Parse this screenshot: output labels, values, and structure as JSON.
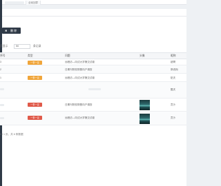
{
  "topbar": {
    "active_tab": "全案回罪"
  },
  "toolbar": {
    "delete_label": "删 除"
  },
  "pager": {
    "prefix": "页显示",
    "page_size": "50",
    "suffix": "条记录"
  },
  "table": {
    "headers": [
      "序号",
      "类型",
      "问题",
      "头像",
      "昵称"
    ],
    "rows": [
      {
        "id": "3",
        "type": "一事一议",
        "type_color": "orange",
        "question": "远程访—向试大学第交试卷",
        "has_avatar": false,
        "nickname": "超哥"
      },
      {
        "id": "2",
        "type": "",
        "type_color": "",
        "question": "日期刊院校院基向户调查",
        "has_avatar": false,
        "nickname": "郭说而"
      },
      {
        "id": "1",
        "type": "一事一议",
        "type_color": "orange",
        "question": "远程访—向试大学第交试卷",
        "has_avatar": false,
        "nickname": "贴夫"
      },
      {
        "id": "",
        "type": "",
        "type_color": "",
        "question": "",
        "has_avatar": false,
        "nickname": "酷夫"
      },
      {
        "id": "",
        "type": "一事一议",
        "type_color": "red",
        "question": "日期刊院校院基向户调查",
        "has_avatar": true,
        "nickname": "贡沙"
      },
      {
        "id": "",
        "type": "一事一议",
        "type_color": "red",
        "question": "远程访—向试大学第交试卷",
        "has_avatar": true,
        "nickname": "贡沙"
      }
    ]
  },
  "footer": {
    "summary": "1 / 1 页，共 6 条数据"
  },
  "colors": {
    "sidebar": "#2f3a47",
    "button": "#2f3a47",
    "badge_orange": "#f0a53a",
    "badge_red": "#e05a4a"
  }
}
